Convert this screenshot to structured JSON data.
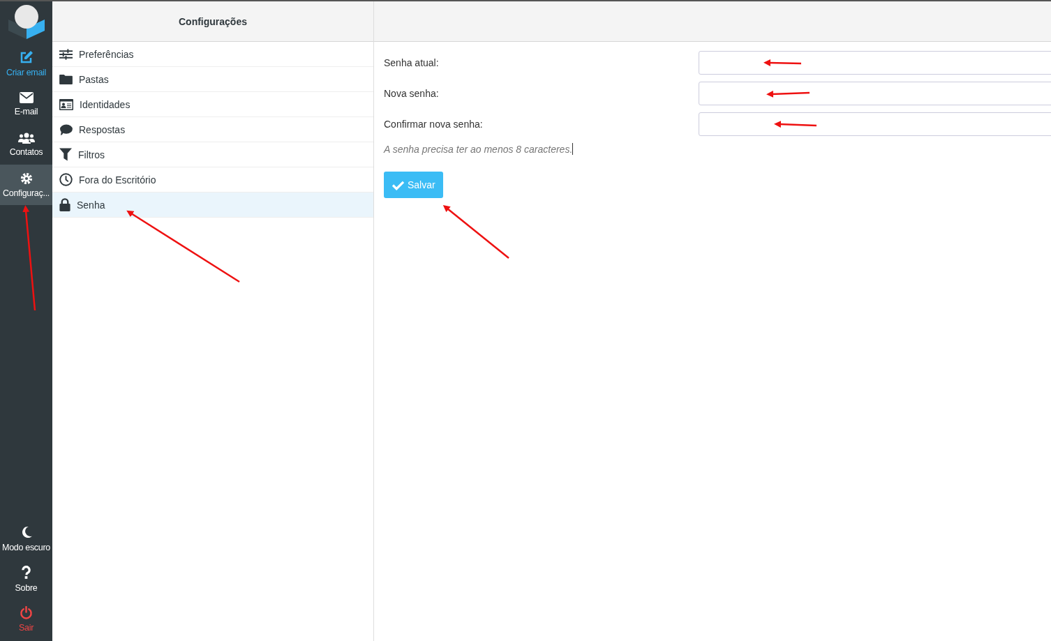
{
  "nav": {
    "items": [
      {
        "label": "Criar email",
        "kind": "compose",
        "selected": false
      },
      {
        "label": "E-mail",
        "kind": "nav",
        "selected": false
      },
      {
        "label": "Contatos",
        "kind": "nav",
        "selected": false
      },
      {
        "label": "Configuraç...",
        "kind": "nav",
        "selected": true
      }
    ],
    "bottom_items": [
      {
        "label": "Modo escuro",
        "kind": "nav"
      },
      {
        "label": "Sobre",
        "kind": "nav"
      },
      {
        "label": "Sair",
        "kind": "danger"
      }
    ]
  },
  "settings": {
    "title": "Configurações",
    "items": [
      {
        "label": "Preferências",
        "selected": false
      },
      {
        "label": "Pastas",
        "selected": false
      },
      {
        "label": "Identidades",
        "selected": false
      },
      {
        "label": "Respostas",
        "selected": false
      },
      {
        "label": "Filtros",
        "selected": false
      },
      {
        "label": "Fora do Escritório",
        "selected": false
      },
      {
        "label": "Senha",
        "selected": true
      }
    ]
  },
  "form": {
    "fields": [
      {
        "label": "Senha atual:"
      },
      {
        "label": "Nova senha:"
      },
      {
        "label": "Confirmar nova senha:"
      }
    ],
    "hint": "A senha precisa ter ao menos 8 caracteres.",
    "save_button": "Salvar"
  }
}
